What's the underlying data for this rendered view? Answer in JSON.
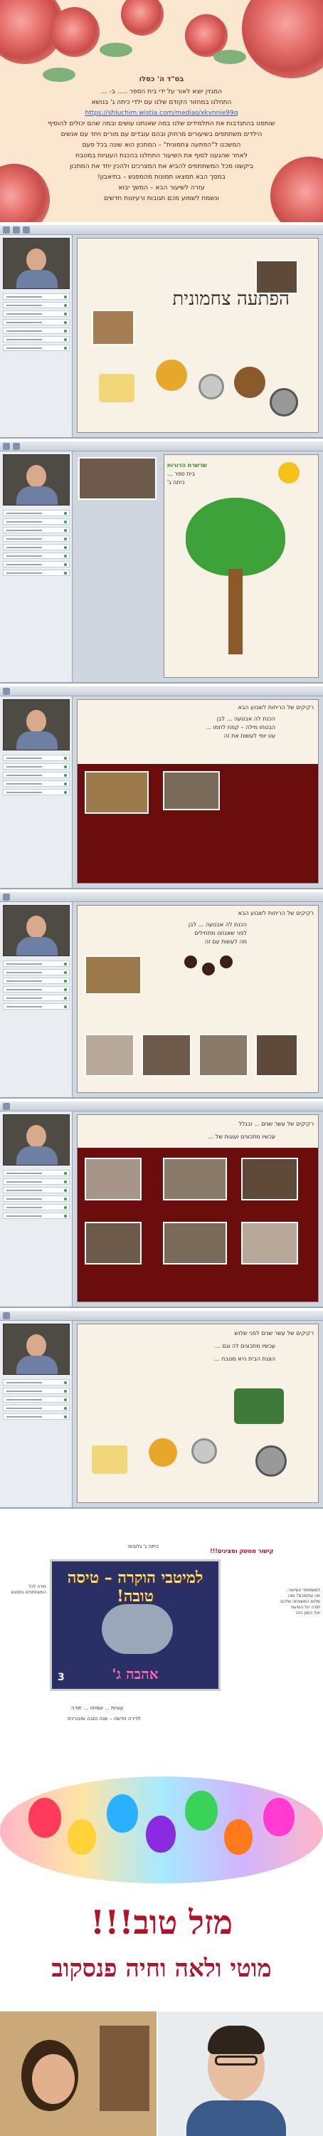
{
  "header": {
    "title": "בס\"ד   ה' כסלו",
    "lines": [
      "המגזין יוצא לאור על ידי בית הספר ..... ב- ...",
      "התחלנו במחזור הקודם שלנו עם ילדי כיתה ג' בנושא",
      "https://shluchim.wistia.com/medias/xkvnnie99q",
      "שותפנו בהתנדבות את התלמידים שלנו במה שאנחנו עושים ובמה שהם יכולים להוסיף",
      "הילדים משתתפים בשיעורים מרחוק ובהם עובדים עם מורים ויחד עם אנשים",
      "המשכנו ל\"הפתעה צחמונית\" – המתכון הוא שונה בכל פעם",
      "לאחר שהגענו לסוף את השיעור התחלנו בהכנת העוגיות במטבח",
      "ביקשנו מכל המשתתפים להביא את המצרכים ולהכין יחד את המתכון",
      "במסך הבא תמצאו תמונות מהמפגש – בתיאבון!",
      "עזרה לשיעור הבא – המשך יבוא",
      "ונשמח לשמוע מכם תגובות ורעיונות חדשים"
    ],
    "link_label": "https://shluchim.wistia.com/medias/xkvnnie99q"
  },
  "shots": [
    {
      "slide_title": "הפתעה צחמונית",
      "slide_lines": [],
      "colors": {
        "accent": "#2b2b2b"
      }
    },
    {
      "slide_title": "",
      "slide_lines": [
        "שרשרת הדורות",
        "בית ספר ...",
        "כיתה ג'"
      ],
      "colors": {
        "accent": "#3a8f2a"
      }
    },
    {
      "slide_title": "",
      "slide_lines": [
        "רקיקים של הריחות לשבוע הבא",
        "הכנת לה אבטעה ... לבן",
        "הבטחו מילה – קמח לחמו ...",
        "עט יופי לעשות את זה"
      ],
      "colors": {
        "accent": "#6b0d0d"
      }
    },
    {
      "slide_title": "",
      "slide_lines": [
        "רקיקים של הריחות לשבוע הבא",
        "הכנת לה אבטעה ... לבן",
        "לפני שאנחנו מתחילים",
        "מה לעשות עם זה"
      ],
      "colors": {
        "accent": "#2b2b2b"
      }
    },
    {
      "slide_title": "",
      "slide_lines": [
        "רקיקים של עשר שנים ... ובגלל",
        "עכשיו מתכונים ועוגות של ..."
      ],
      "colors": {
        "accent": "#6b0d0d"
      }
    },
    {
      "slide_title": "",
      "slide_lines": [
        "רקיקים של עשר שנים לפני שלוש",
        "עכשיו מתכונים לה וגם ...",
        "הצגת הבית היא מטבח ..."
      ],
      "colors": {
        "accent": "#2b2b2b"
      }
    }
  ],
  "collage": {
    "top_caption": "כיתה ג' גלובוס",
    "top_red": "קישור ממשק ומציגים!!!",
    "left_note": [
      "תודה לכל",
      "המשתתפים במפגש"
    ],
    "right_note": [
      "למשתתפי השיעור:",
      "מה שלומכם? ומה",
      "שלום המשפחה שלכם",
      "תודה על השיעור",
      "ועל הזמן הזה"
    ],
    "bottom_caption": "עוגיות ... שמחה ... תודה",
    "bottom_caption2": "לדירה חדשה – שנה טובה ומבורכת",
    "film_title": "למיטבי הוקרה – טיסה טובה!",
    "film_bottom": "אהבה ג'",
    "film_number": "3"
  },
  "celebration": {
    "mazal": "מזל טוב!!!",
    "names": "מוטי ולאה וחיה פנסקוב"
  }
}
